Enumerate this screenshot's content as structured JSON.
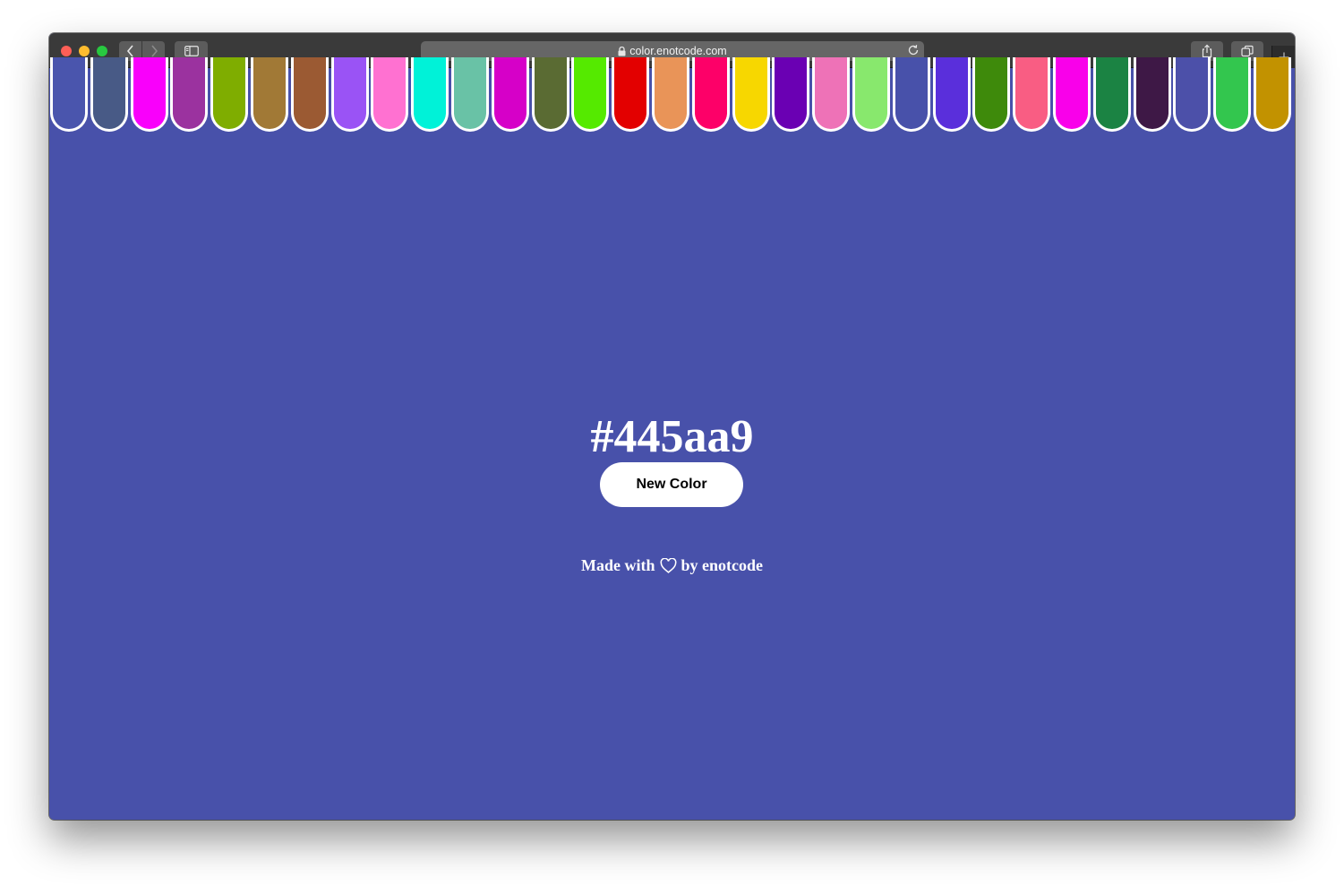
{
  "browser": {
    "url": "color.enotcode.com"
  },
  "page": {
    "background": "#4851aa",
    "current_hex": "#445aa9",
    "button_label": "New Color",
    "credit_prefix": "Made with",
    "credit_icon": "heart-icon",
    "credit_suffix": "by enotcode"
  },
  "swatches": [
    "#4a55ad",
    "#485a86",
    "#f900fb",
    "#9b329f",
    "#7fad00",
    "#a17936",
    "#9b5a33",
    "#9a53f5",
    "#ff71d1",
    "#00f2d8",
    "#69c2a6",
    "#d600c8",
    "#5a6b33",
    "#55ea00",
    "#e30000",
    "#e99458",
    "#fd0068",
    "#f7d700",
    "#6a00b3",
    "#ee72b7",
    "#88e86d",
    "#4851aa",
    "#5a2fdb",
    "#3e8a0b",
    "#f95d83",
    "#f900ea",
    "#1b8343",
    "#3e1846",
    "#4c50a9",
    "#33c64e",
    "#c29200"
  ]
}
